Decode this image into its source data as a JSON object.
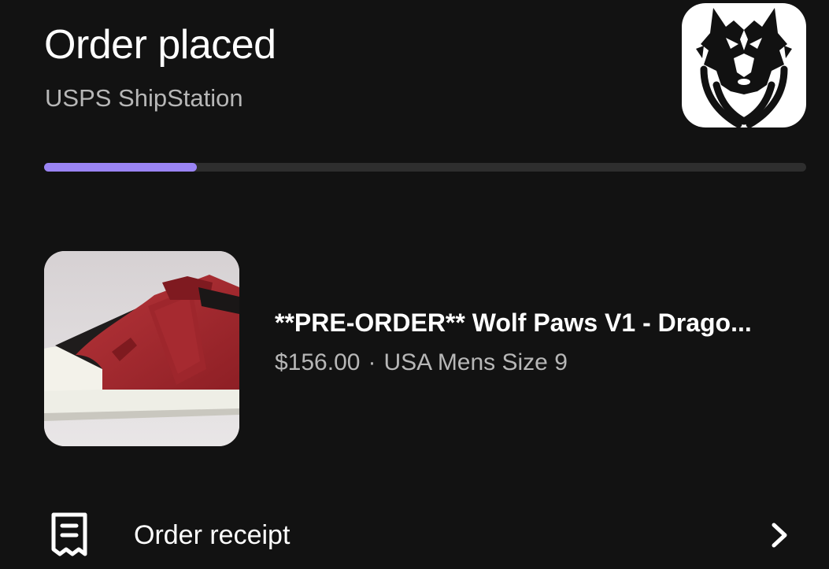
{
  "header": {
    "title": "Order placed",
    "carrier": "USPS ShipStation",
    "store_logo_icon": "wolf-logo-icon"
  },
  "progress": {
    "fraction": 0.2,
    "fill_color": "#9a84f4",
    "track_color": "#2e2e2e"
  },
  "product": {
    "image_icon": "red-sneaker-image",
    "name": "**PRE-ORDER** Wolf Paws V1 - Drago...",
    "price": "$156.00",
    "separator": "·",
    "variant": "USA Mens Size 9"
  },
  "receipt": {
    "icon": "receipt-icon",
    "label": "Order receipt",
    "chevron_icon": "chevron-right-icon"
  },
  "colors": {
    "background": "#121212",
    "primary_text": "#ffffff",
    "secondary_text": "#b7b7b7"
  }
}
